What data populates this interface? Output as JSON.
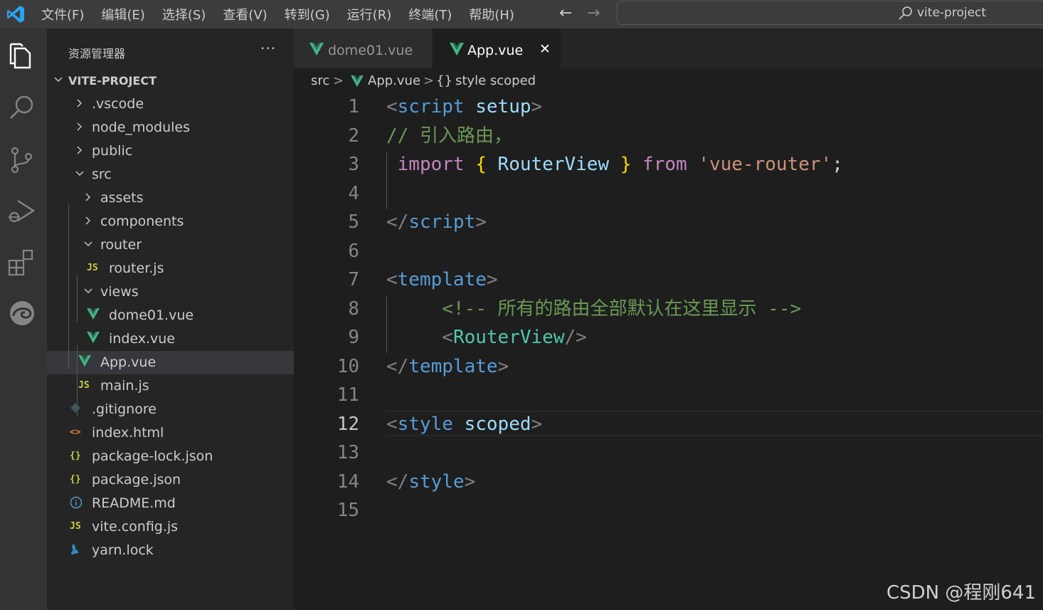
{
  "menu": {
    "items": [
      "文件(F)",
      "编辑(E)",
      "选择(S)",
      "查看(V)",
      "转到(G)",
      "运行(R)",
      "终端(T)",
      "帮助(H)"
    ],
    "back": "←",
    "forward": "→"
  },
  "search": {
    "label": "vite-project"
  },
  "sidebar": {
    "title": "资源管理器",
    "more": "···",
    "tree": [
      {
        "label": "VITE-PROJECT",
        "type": "root",
        "indent": 0,
        "expanded": true
      },
      {
        "label": ".vscode",
        "type": "folder",
        "indent": 1,
        "expanded": false
      },
      {
        "label": "node_modules",
        "type": "folder",
        "indent": 1,
        "expanded": false
      },
      {
        "label": "public",
        "type": "folder",
        "indent": 1,
        "expanded": false
      },
      {
        "label": "src",
        "type": "folder",
        "indent": 1,
        "expanded": true
      },
      {
        "label": "assets",
        "type": "folder",
        "indent": 2,
        "expanded": false
      },
      {
        "label": "components",
        "type": "folder",
        "indent": 2,
        "expanded": false
      },
      {
        "label": "router",
        "type": "folder",
        "indent": 2,
        "expanded": true
      },
      {
        "label": "router.js",
        "type": "js",
        "indent": 3
      },
      {
        "label": "views",
        "type": "folder",
        "indent": 2,
        "expanded": true
      },
      {
        "label": "dome01.vue",
        "type": "vue",
        "indent": 3
      },
      {
        "label": "index.vue",
        "type": "vue",
        "indent": 3
      },
      {
        "label": "App.vue",
        "type": "vue",
        "indent": 2,
        "selected": true
      },
      {
        "label": "main.js",
        "type": "js",
        "indent": 2
      },
      {
        "label": ".gitignore",
        "type": "git",
        "indent": 1
      },
      {
        "label": "index.html",
        "type": "html",
        "indent": 1
      },
      {
        "label": "package-lock.json",
        "type": "json",
        "indent": 1
      },
      {
        "label": "package.json",
        "type": "json",
        "indent": 1
      },
      {
        "label": "README.md",
        "type": "info",
        "indent": 1
      },
      {
        "label": "vite.config.js",
        "type": "js",
        "indent": 1
      },
      {
        "label": "yarn.lock",
        "type": "yarn",
        "indent": 1
      }
    ]
  },
  "tabs": [
    {
      "label": "dome01.vue",
      "active": false
    },
    {
      "label": "App.vue",
      "active": true,
      "close": "✕"
    }
  ],
  "breadcrumb": {
    "folder": "src",
    "file": "App.vue",
    "symbol": "style scoped",
    "symbol_icon": "{}",
    "sep": ">"
  },
  "editor": {
    "current_line": 12,
    "lines": [
      {
        "n": "1",
        "tokens": [
          [
            "bracket",
            "<"
          ],
          [
            "tag",
            "script"
          ],
          [
            "punc",
            " "
          ],
          [
            "attr",
            "setup"
          ],
          [
            "bracket",
            ">"
          ]
        ]
      },
      {
        "n": "2",
        "tokens": [
          [
            "comment",
            "// 引入路由，"
          ]
        ]
      },
      {
        "n": "3",
        "tokens": [
          [
            "punc",
            " "
          ],
          [
            "keyword",
            "import"
          ],
          [
            "punc",
            " "
          ],
          [
            "brace",
            "{"
          ],
          [
            "punc",
            " "
          ],
          [
            "ident",
            "RouterView"
          ],
          [
            "punc",
            " "
          ],
          [
            "brace",
            "}"
          ],
          [
            "punc",
            " "
          ],
          [
            "keyword",
            "from"
          ],
          [
            "punc",
            " "
          ],
          [
            "string",
            "'vue-router'"
          ],
          [
            "punc",
            ";"
          ]
        ]
      },
      {
        "n": "4",
        "tokens": []
      },
      {
        "n": "5",
        "tokens": [
          [
            "bracket",
            "</"
          ],
          [
            "tag",
            "script"
          ],
          [
            "bracket",
            ">"
          ]
        ]
      },
      {
        "n": "6",
        "tokens": []
      },
      {
        "n": "7",
        "tokens": [
          [
            "bracket",
            "<"
          ],
          [
            "tag",
            "template"
          ],
          [
            "bracket",
            ">"
          ]
        ]
      },
      {
        "n": "8",
        "tokens": [
          [
            "punc",
            "     "
          ],
          [
            "comment",
            "<!-- 所有的路由全部默认在这里显示 -->"
          ]
        ]
      },
      {
        "n": "9",
        "tokens": [
          [
            "punc",
            "     "
          ],
          [
            "bracket",
            "<"
          ],
          [
            "comp",
            "RouterView"
          ],
          [
            "bracket",
            "/>"
          ]
        ]
      },
      {
        "n": "10",
        "tokens": [
          [
            "bracket",
            "</"
          ],
          [
            "tag",
            "template"
          ],
          [
            "bracket",
            ">"
          ]
        ]
      },
      {
        "n": "11",
        "tokens": []
      },
      {
        "n": "12",
        "tokens": [
          [
            "bracket",
            "<"
          ],
          [
            "tag",
            "style"
          ],
          [
            "punc",
            " "
          ],
          [
            "attr",
            "scoped"
          ],
          [
            "bracket",
            ">"
          ]
        ]
      },
      {
        "n": "13",
        "tokens": []
      },
      {
        "n": "14",
        "tokens": [
          [
            "bracket",
            "</"
          ],
          [
            "tag",
            "style"
          ],
          [
            "bracket",
            ">"
          ]
        ]
      },
      {
        "n": "15",
        "tokens": []
      }
    ]
  },
  "watermark": "CSDN @程刚641",
  "colors": {
    "vue": "#41b883",
    "js": "#cbcb41",
    "json": "#cbcb41",
    "html": "#e37933",
    "git": "#41535b",
    "info": "#519aba",
    "yarn": "#2c8ebb",
    "accent": "#007acc"
  }
}
